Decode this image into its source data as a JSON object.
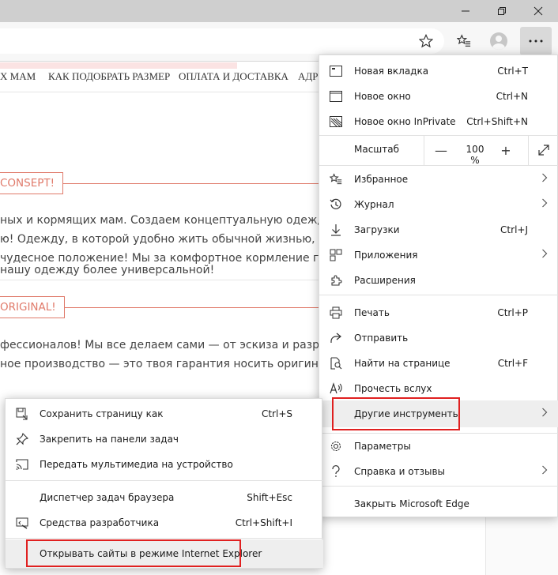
{
  "window": {
    "minimize_icon": "minimize-icon",
    "maximize_icon": "restore-icon",
    "close_icon": "close-icon"
  },
  "toolbar": {
    "favorite_icon": "star-icon",
    "favorites_icon": "favorites-list-icon",
    "profile_icon": "avatar-icon",
    "more_icon": "more-icon"
  },
  "page": {
    "nav": [
      "Х МАМ",
      "КАК ПОДОБРАТЬ РАЗМЕР",
      "ОПЛАТА И ДОСТАВКА",
      "АДРЕ"
    ],
    "section1_title": "CONSEPT!",
    "section1_lines": [
      "ных и кормящих мам. Создаем концептуальную одежду дл",
      "ю! Одежду, в которой удобно жить обычной жизнью, даже",
      "чудесное положение! Мы за комфортное кормление груды",
      "нашу одежду более универсальной!"
    ],
    "section2_title": "ORIGINAL!",
    "section2_lines": [
      "фессионалов! Мы все делаем сами — от эскиза и разработ",
      "ное производство — это твоя гарантия носить оригинальн"
    ]
  },
  "menu": {
    "new_tab": "Новая вкладка",
    "new_tab_sc": "Ctrl+T",
    "new_window": "Новое окно",
    "new_window_sc": "Ctrl+N",
    "new_inprivate": "Новое окно InPrivate",
    "new_inprivate_sc": "Ctrl+Shift+N",
    "zoom_label": "Масштаб",
    "zoom_value": "100 %",
    "zoom_minus": "—",
    "zoom_plus": "+",
    "favorites": "Избранное",
    "history": "Журнал",
    "downloads": "Загрузки",
    "downloads_sc": "Ctrl+J",
    "apps": "Приложения",
    "extensions": "Расширения",
    "print": "Печать",
    "print_sc": "Ctrl+P",
    "share": "Отправить",
    "find": "Найти на странице",
    "find_sc": "Ctrl+F",
    "read_aloud": "Прочесть вслух",
    "more_tools": "Другие инструменты",
    "settings": "Параметры",
    "help": "Справка и отзывы",
    "close_edge": "Закрыть Microsoft Edge"
  },
  "submenu": {
    "save_page": "Сохранить страницу как",
    "save_page_sc": "Ctrl+S",
    "pin_taskbar": "Закрепить на панели задач",
    "cast": "Передать мультимедиа на устройство",
    "task_manager": "Диспетчер задач браузера",
    "task_manager_sc": "Shift+Esc",
    "dev_tools": "Средства разработчика",
    "dev_tools_sc": "Ctrl+Shift+I",
    "ie_mode": "Открывать сайты в режиме Internet Explorer"
  },
  "colors": {
    "accent_red": "#e02020",
    "section_border": "#e07a6a"
  }
}
